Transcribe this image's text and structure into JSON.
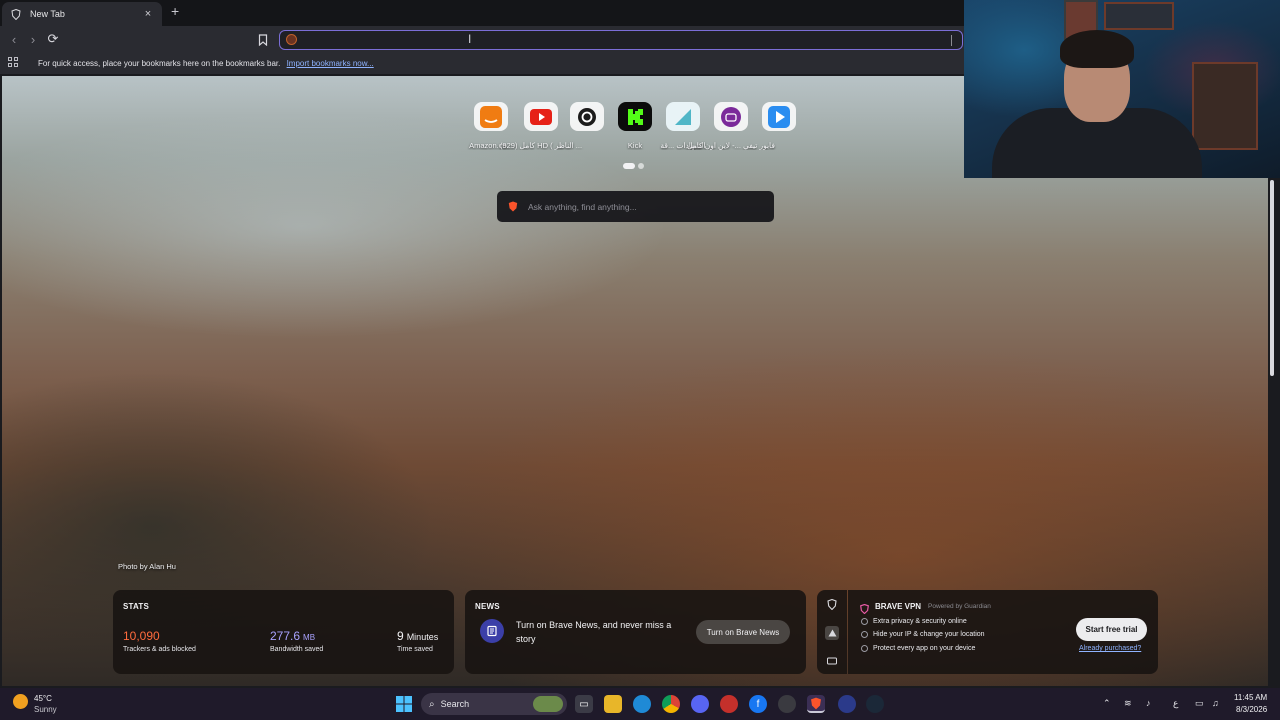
{
  "browser": {
    "tab": {
      "title": "New Tab",
      "close_glyph": "×"
    },
    "new_tab_glyph": "+",
    "toolbar": {
      "back_glyph": "‹",
      "forward_glyph": "›",
      "reload_glyph": "⟳",
      "address_value": ""
    },
    "bookmarks_bar": {
      "message": "For quick access, place your bookmarks here on the bookmarks bar.",
      "import_link": "Import bookmarks now..."
    }
  },
  "new_tab_page": {
    "top_sites": [
      {
        "label": "Amazon.co...",
        "icon": "amazon-icon",
        "color": "#f07c12"
      },
      {
        "label": "(929) كامل HD ( الناظر ...",
        "icon": "youtube-icon",
        "color": "#e62117"
      },
      {
        "label": "",
        "icon": "threads-icon",
        "color": "#1b1b1b"
      },
      {
        "label": "Kick",
        "icon": "kick-icon",
        "color": "#53fc18"
      },
      {
        "label": "الشهادات ...قة",
        "icon": "certificate-icon",
        "color": "#4fb6c7"
      },
      {
        "label": "فابور تيفي ...- لاين اون كامل",
        "icon": "fabor-tv-icon",
        "color": "#7b2a9a"
      },
      {
        "label": "",
        "icon": "play-icon",
        "color": "#2a8df0"
      }
    ],
    "search_placeholder": "Ask anything, find anything...",
    "photo_credit": "Photo by Alan Hu",
    "stats": {
      "title": "STATS",
      "trackers_value": "10,090",
      "trackers_caption": "Trackers & ads blocked",
      "bandwidth_value": "277.6",
      "bandwidth_unit": "MB",
      "bandwidth_caption": "Bandwidth saved",
      "time_value": "9",
      "time_unit": "Minutes",
      "time_caption": "Time saved"
    },
    "news": {
      "title": "NEWS",
      "message": "Turn on Brave News, and never miss a story",
      "button": "Turn on Brave News"
    },
    "vpn": {
      "title": "BRAVE VPN",
      "powered_by": "Powered by  Guardian",
      "features": [
        "Extra privacy & security online",
        "Hide your IP & change your location",
        "Protect every app on your device"
      ],
      "trial_button": "Start free trial",
      "purchased_link": "Already purchased?"
    }
  },
  "taskbar": {
    "weather_temp": "45°C",
    "weather_condition": "Sunny",
    "search_label": "Search",
    "tray_language": "ع",
    "clock_time": "11:45 AM",
    "clock_date": "8/3/2026"
  },
  "colors": {
    "accent": "#7b6ed6",
    "link": "#8fb3ff",
    "brave_orange": "#fb542b",
    "stats_orange": "#ff6b3d",
    "stats_purple": "#a9a2ff"
  }
}
